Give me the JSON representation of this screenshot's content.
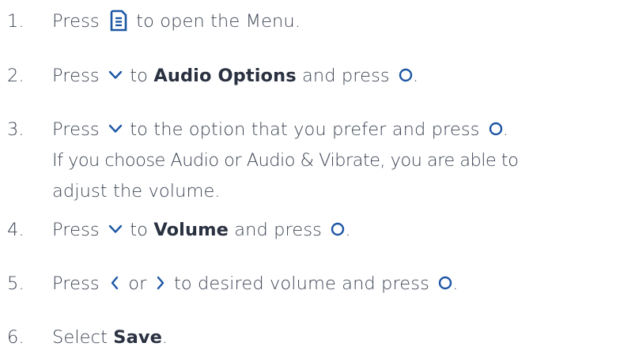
{
  "steps": [
    {
      "number": "1.",
      "text_before": "Press",
      "text_after": "to open the Menu.",
      "icon": "menu-icon"
    },
    {
      "number": "2.",
      "text_before": "Press",
      "text_mid": "to",
      "bold": "Audio Options",
      "text_after": "and press",
      "end": ".",
      "icons": [
        "chevron-down-icon",
        "circle-ok-icon"
      ]
    },
    {
      "number": "3.",
      "text_before": "Press",
      "text_mid": "to the option that you prefer and press",
      "end": ".",
      "line2": "If you choose Audio or Audio & Vibrate, you are able to",
      "line3": "adjust the volume.",
      "icons": [
        "chevron-down-icon",
        "circle-ok-icon"
      ]
    },
    {
      "number": "4.",
      "text_before": "Press",
      "text_mid": "to",
      "bold": "Volume",
      "text_after": "and press",
      "end": ".",
      "icons": [
        "chevron-down-icon",
        "circle-ok-icon"
      ]
    },
    {
      "number": "5.",
      "text_before": "Press",
      "text_or": "or",
      "text_mid": "to desired volume and press",
      "end": ".",
      "icons": [
        "chevron-left-icon",
        "chevron-right-icon",
        "circle-ok-icon"
      ]
    },
    {
      "number": "6.",
      "text_before": "Select",
      "bold": "Save",
      "end": "."
    }
  ],
  "colors": {
    "text": "#3d4554",
    "icon": "#1c56a4"
  }
}
